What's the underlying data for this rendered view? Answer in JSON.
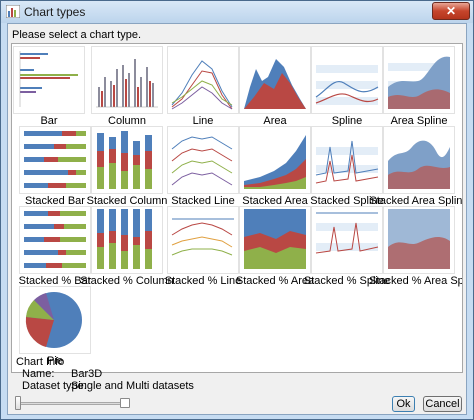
{
  "window": {
    "title": "Chart types",
    "close_label": "✕"
  },
  "prompt": "Please select a chart type.",
  "chart_types": [
    {
      "label": "Bar"
    },
    {
      "label": "Column"
    },
    {
      "label": "Line"
    },
    {
      "label": "Area"
    },
    {
      "label": "Spline"
    },
    {
      "label": "Area Spline"
    },
    {
      "label": "Stacked Bar"
    },
    {
      "label": "Stacked Column"
    },
    {
      "label": "Stacked Line"
    },
    {
      "label": "Stacked Area"
    },
    {
      "label": "Stacked Spline"
    },
    {
      "label": "Stacked Area Spline"
    },
    {
      "label": "Stacked % Bar"
    },
    {
      "label": "Stacked % Column"
    },
    {
      "label": "Stacked % Line"
    },
    {
      "label": "Stacked % Area"
    },
    {
      "label": "Stacked % Spline"
    },
    {
      "label": "Stacked % Area Spline"
    },
    {
      "label": "Pie"
    }
  ],
  "info": {
    "heading": "Chart Info",
    "name_label": "Name:",
    "name_value": "Bar3D",
    "type_label": "Dataset type:",
    "type_value": "Single and Multi datasets"
  },
  "buttons": {
    "ok": "Ok",
    "cancel": "Cancel"
  },
  "colors": {
    "blue": "#4f7fba",
    "red": "#b94844",
    "green": "#8fb04a",
    "purple": "#7c5fa0"
  }
}
